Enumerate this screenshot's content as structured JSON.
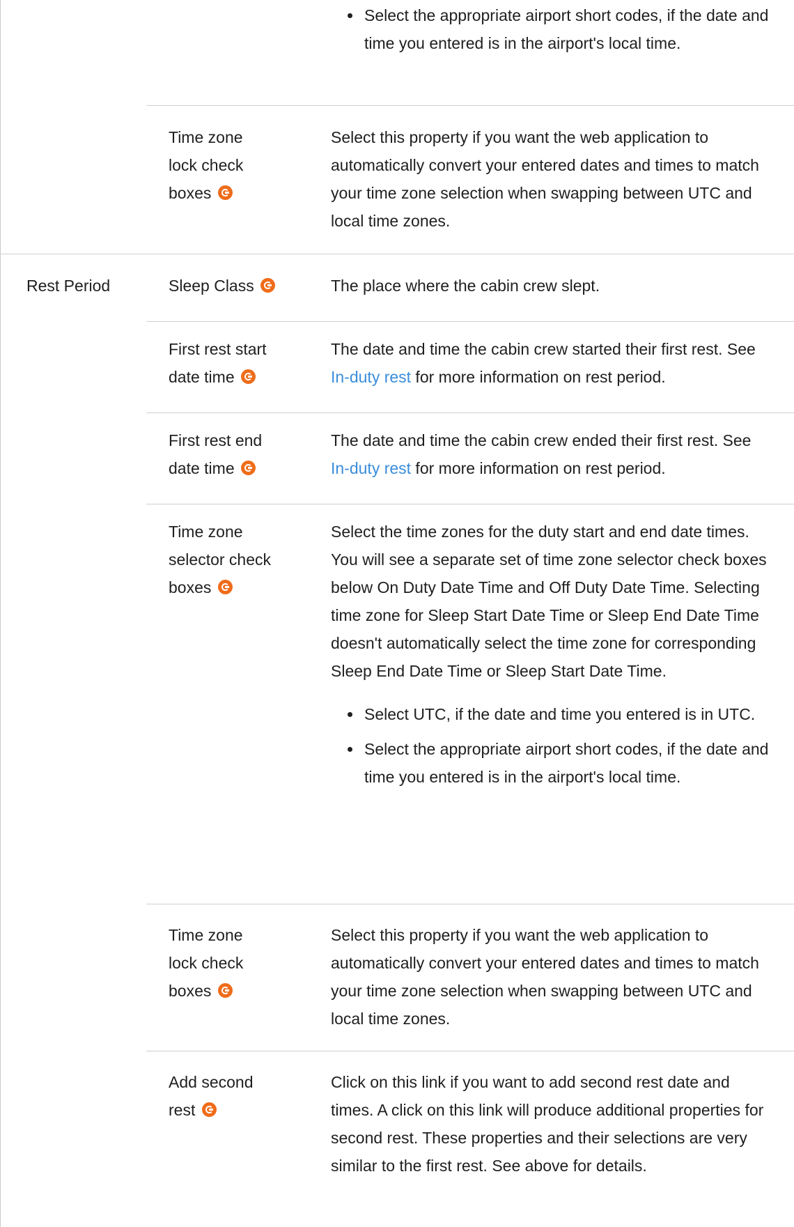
{
  "colors": {
    "accent_icon": "#ef6c1a",
    "link": "#3a8ddb",
    "text": "#1f1f1f",
    "rule": "#cfcfcf"
  },
  "top_fragment": {
    "bullet_1": "Select the appropriate airport short codes, if the date and time you entered is in the airport's local time."
  },
  "top_row": {
    "prop_lines": [
      "Time zone",
      "lock check",
      "boxes"
    ],
    "desc": "Select this property if you want the web application to automatically convert your entered dates and times to match your time zone selection when swapping between UTC and local time zones."
  },
  "rest_period": {
    "group_label": "Rest Period",
    "rows": [
      {
        "prop": "Sleep Class",
        "desc": "The place where the cabin crew slept."
      },
      {
        "prop_lines": [
          "First rest start",
          "date time"
        ],
        "desc_before": "The date and time the cabin crew started their first rest. See ",
        "link": "In-duty rest",
        "desc_after": " for more information on rest period."
      },
      {
        "prop_lines": [
          "First rest end",
          "date time"
        ],
        "desc_before": "The date and time the cabin crew ended their first rest. See ",
        "link": "In-duty rest",
        "desc_after": " for more information on rest period."
      },
      {
        "prop_lines": [
          "Time zone",
          "selector check",
          "boxes"
        ],
        "desc": "Select the time zones for the duty start and end date times. You will see a separate set of time zone selector check boxes below On Duty Date Time and Off Duty Date Time. Selecting time zone for Sleep Start Date Time or Sleep End Date Time doesn't automatically select the time zone for corresponding Sleep End Date Time or Sleep Start Date Time.",
        "bullets": [
          "Select UTC, if the date and time you entered is in UTC.",
          "Select the appropriate airport short codes, if the date and time you entered is in the airport's local time."
        ]
      },
      {
        "prop_lines": [
          "Time zone",
          "lock check",
          "boxes"
        ],
        "desc": "Select this property if you want the web application to automatically convert your entered dates and times to match your time zone selection when swapping between UTC and local time zones."
      },
      {
        "prop_lines": [
          "Add second",
          "rest"
        ],
        "desc": "Click on this link if you want to add second rest date and times. A click on this link will produce additional properties for second rest. These properties and their selections are very similar to the first rest. See above for details."
      }
    ]
  }
}
